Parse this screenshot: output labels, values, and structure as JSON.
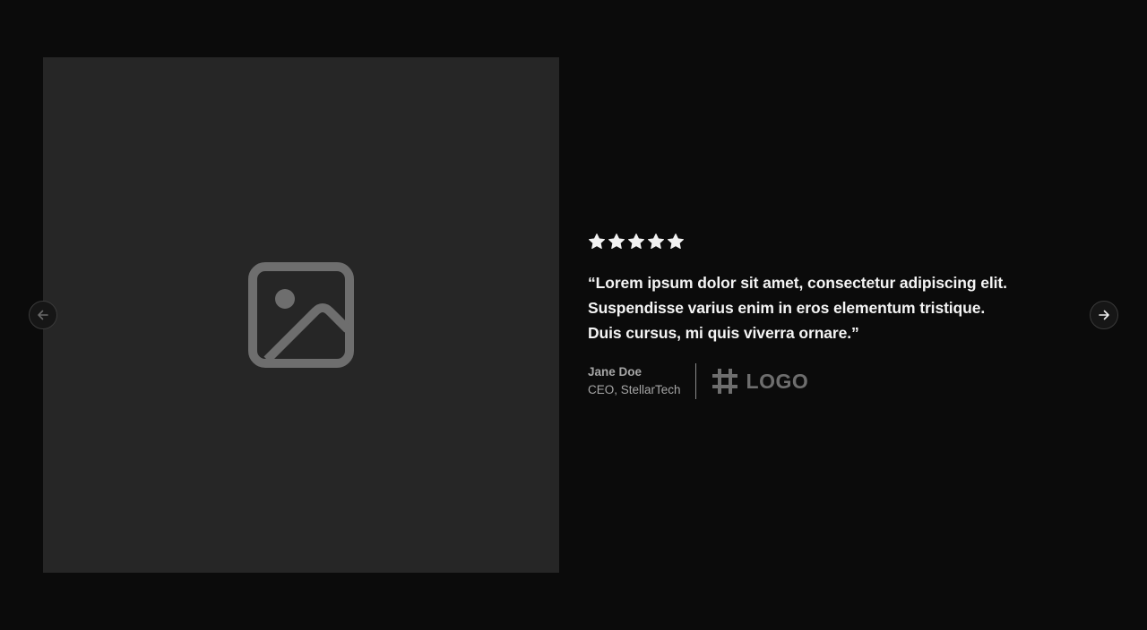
{
  "testimonial": {
    "rating": 5,
    "quote": "“Lorem ipsum dolor sit amet, consectetur adipiscing elit. Suspendisse varius enim in eros elementum tristique. Duis cursus, mi quis viverra ornare.”",
    "author_name": "Jane Doe",
    "author_role": "CEO, StellarTech",
    "logo_text": "LOGO"
  },
  "icons": {
    "image": "image-placeholder-icon",
    "star": "star-icon",
    "prev": "arrow-left-icon",
    "next": "arrow-right-icon",
    "logo": "hash-logo-icon"
  },
  "colors": {
    "background": "#0b0b0b",
    "image_placeholder": "#262626",
    "icon_gray": "#6e6e6e",
    "text": "#f4f4f4",
    "muted_text": "#a6a6a6"
  }
}
